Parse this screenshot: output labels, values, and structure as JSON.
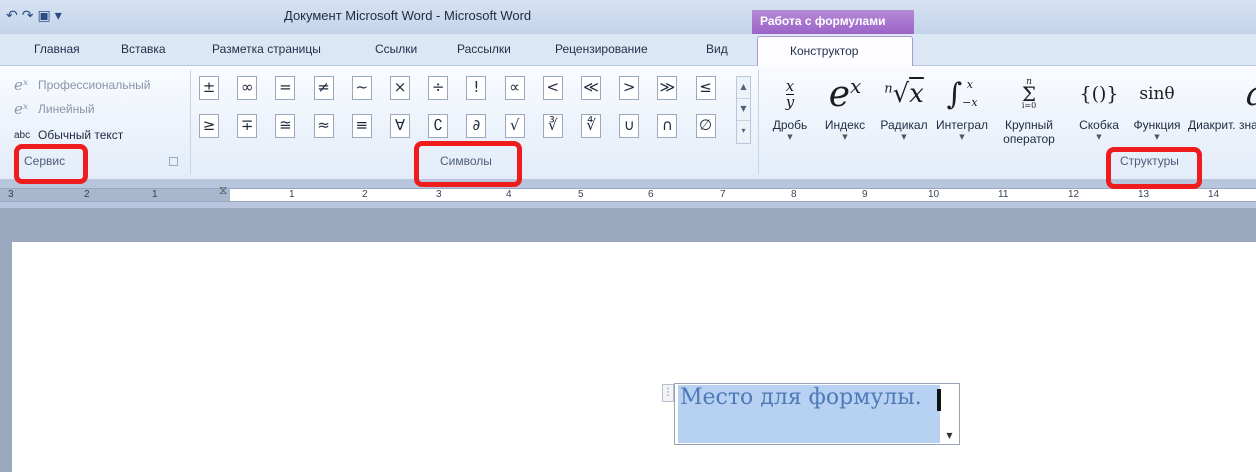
{
  "title_bar": {
    "window_title": "Документ Microsoft Word  -  Microsoft Word",
    "quick_access": [
      "undo-icon",
      "redo-icon",
      "save-icon",
      "customize-icon"
    ],
    "context_group": "Работа с формулами"
  },
  "tabs": [
    "Главная",
    "Вставка",
    "Разметка страницы",
    "Ссылки",
    "Рассылки",
    "Рецензирование",
    "Вид"
  ],
  "context_tab": "Конструктор",
  "ribbon": {
    "service": {
      "items": [
        "Профессиональный",
        "Линейный",
        "Обычный текст"
      ],
      "icons": [
        "𝑒ˣ",
        "𝑒ˣ",
        "abc"
      ],
      "label": "Сервис"
    },
    "symbols": {
      "row1": [
        "±",
        "∞",
        "=",
        "≠",
        "~",
        "×",
        "÷",
        "!",
        "∝",
        "<",
        "≪",
        ">",
        "≫",
        "≤"
      ],
      "row2": [
        "≥",
        "∓",
        "≅",
        "≈",
        "≡",
        "∀",
        "∁",
        "∂",
        "√",
        "∛",
        "∜",
        "∪",
        "∩",
        "∅"
      ],
      "label": "Символы"
    },
    "structures": {
      "items": [
        {
          "name": "Дробь",
          "glyph": "x/y"
        },
        {
          "name": "Индекс",
          "glyph": "eˣ"
        },
        {
          "name": "Радикал",
          "glyph": "ⁿ√x"
        },
        {
          "name": "Интеграл",
          "glyph": "∫ˣ₋ₓ"
        },
        {
          "name": "Крупный оператор",
          "glyph": "Σ"
        },
        {
          "name": "Скобка",
          "glyph": "{()}"
        },
        {
          "name": "Функция",
          "glyph": "sinθ"
        },
        {
          "name": "Диакрит. знак",
          "glyph": "ä"
        }
      ],
      "label": "Структуры"
    }
  },
  "ruler": {
    "numbers": [
      "3",
      "2",
      "1",
      "1",
      "2",
      "3",
      "4",
      "5",
      "6",
      "7",
      "8",
      "9",
      "10",
      "11",
      "12",
      "13",
      "14"
    ]
  },
  "document": {
    "equation_placeholder": "Место для формулы."
  },
  "colors": {
    "highlight": "#ee1c1c",
    "context_tab": "#9b64c8",
    "equation_fill": "#b6d1f1"
  }
}
